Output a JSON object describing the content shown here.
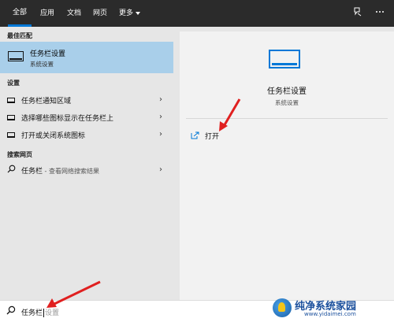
{
  "tabs": [
    "全部",
    "应用",
    "文档",
    "网页",
    "更多"
  ],
  "top_icons": {
    "feedback": "feedback-icon",
    "more": "ellipsis-icon"
  },
  "left": {
    "best_match_label": "最佳匹配",
    "best_match": {
      "title": "任务栏设置",
      "subtitle": "系统设置"
    },
    "settings_label": "设置",
    "settings_items": [
      {
        "label": "任务栏通知区域"
      },
      {
        "label": "选择哪些图标显示在任务栏上"
      },
      {
        "label": "打开或关闭系统图标"
      }
    ],
    "web_label": "搜索网页",
    "web_item": {
      "term": "任务栏",
      "suffix": " - 查看网络搜索结果"
    }
  },
  "right": {
    "title": "任务栏设置",
    "subtitle": "系统设置",
    "open_label": "打开"
  },
  "search": {
    "typed": "任务栏",
    "suggestion": "设置"
  },
  "watermark": {
    "title": "纯净系统家园",
    "url": "www.yidaimei.com"
  },
  "colors": {
    "accent": "#0078d7",
    "highlight": "#a9cfea",
    "topbar": "#2b2b2b",
    "annotation": "#e02020"
  }
}
